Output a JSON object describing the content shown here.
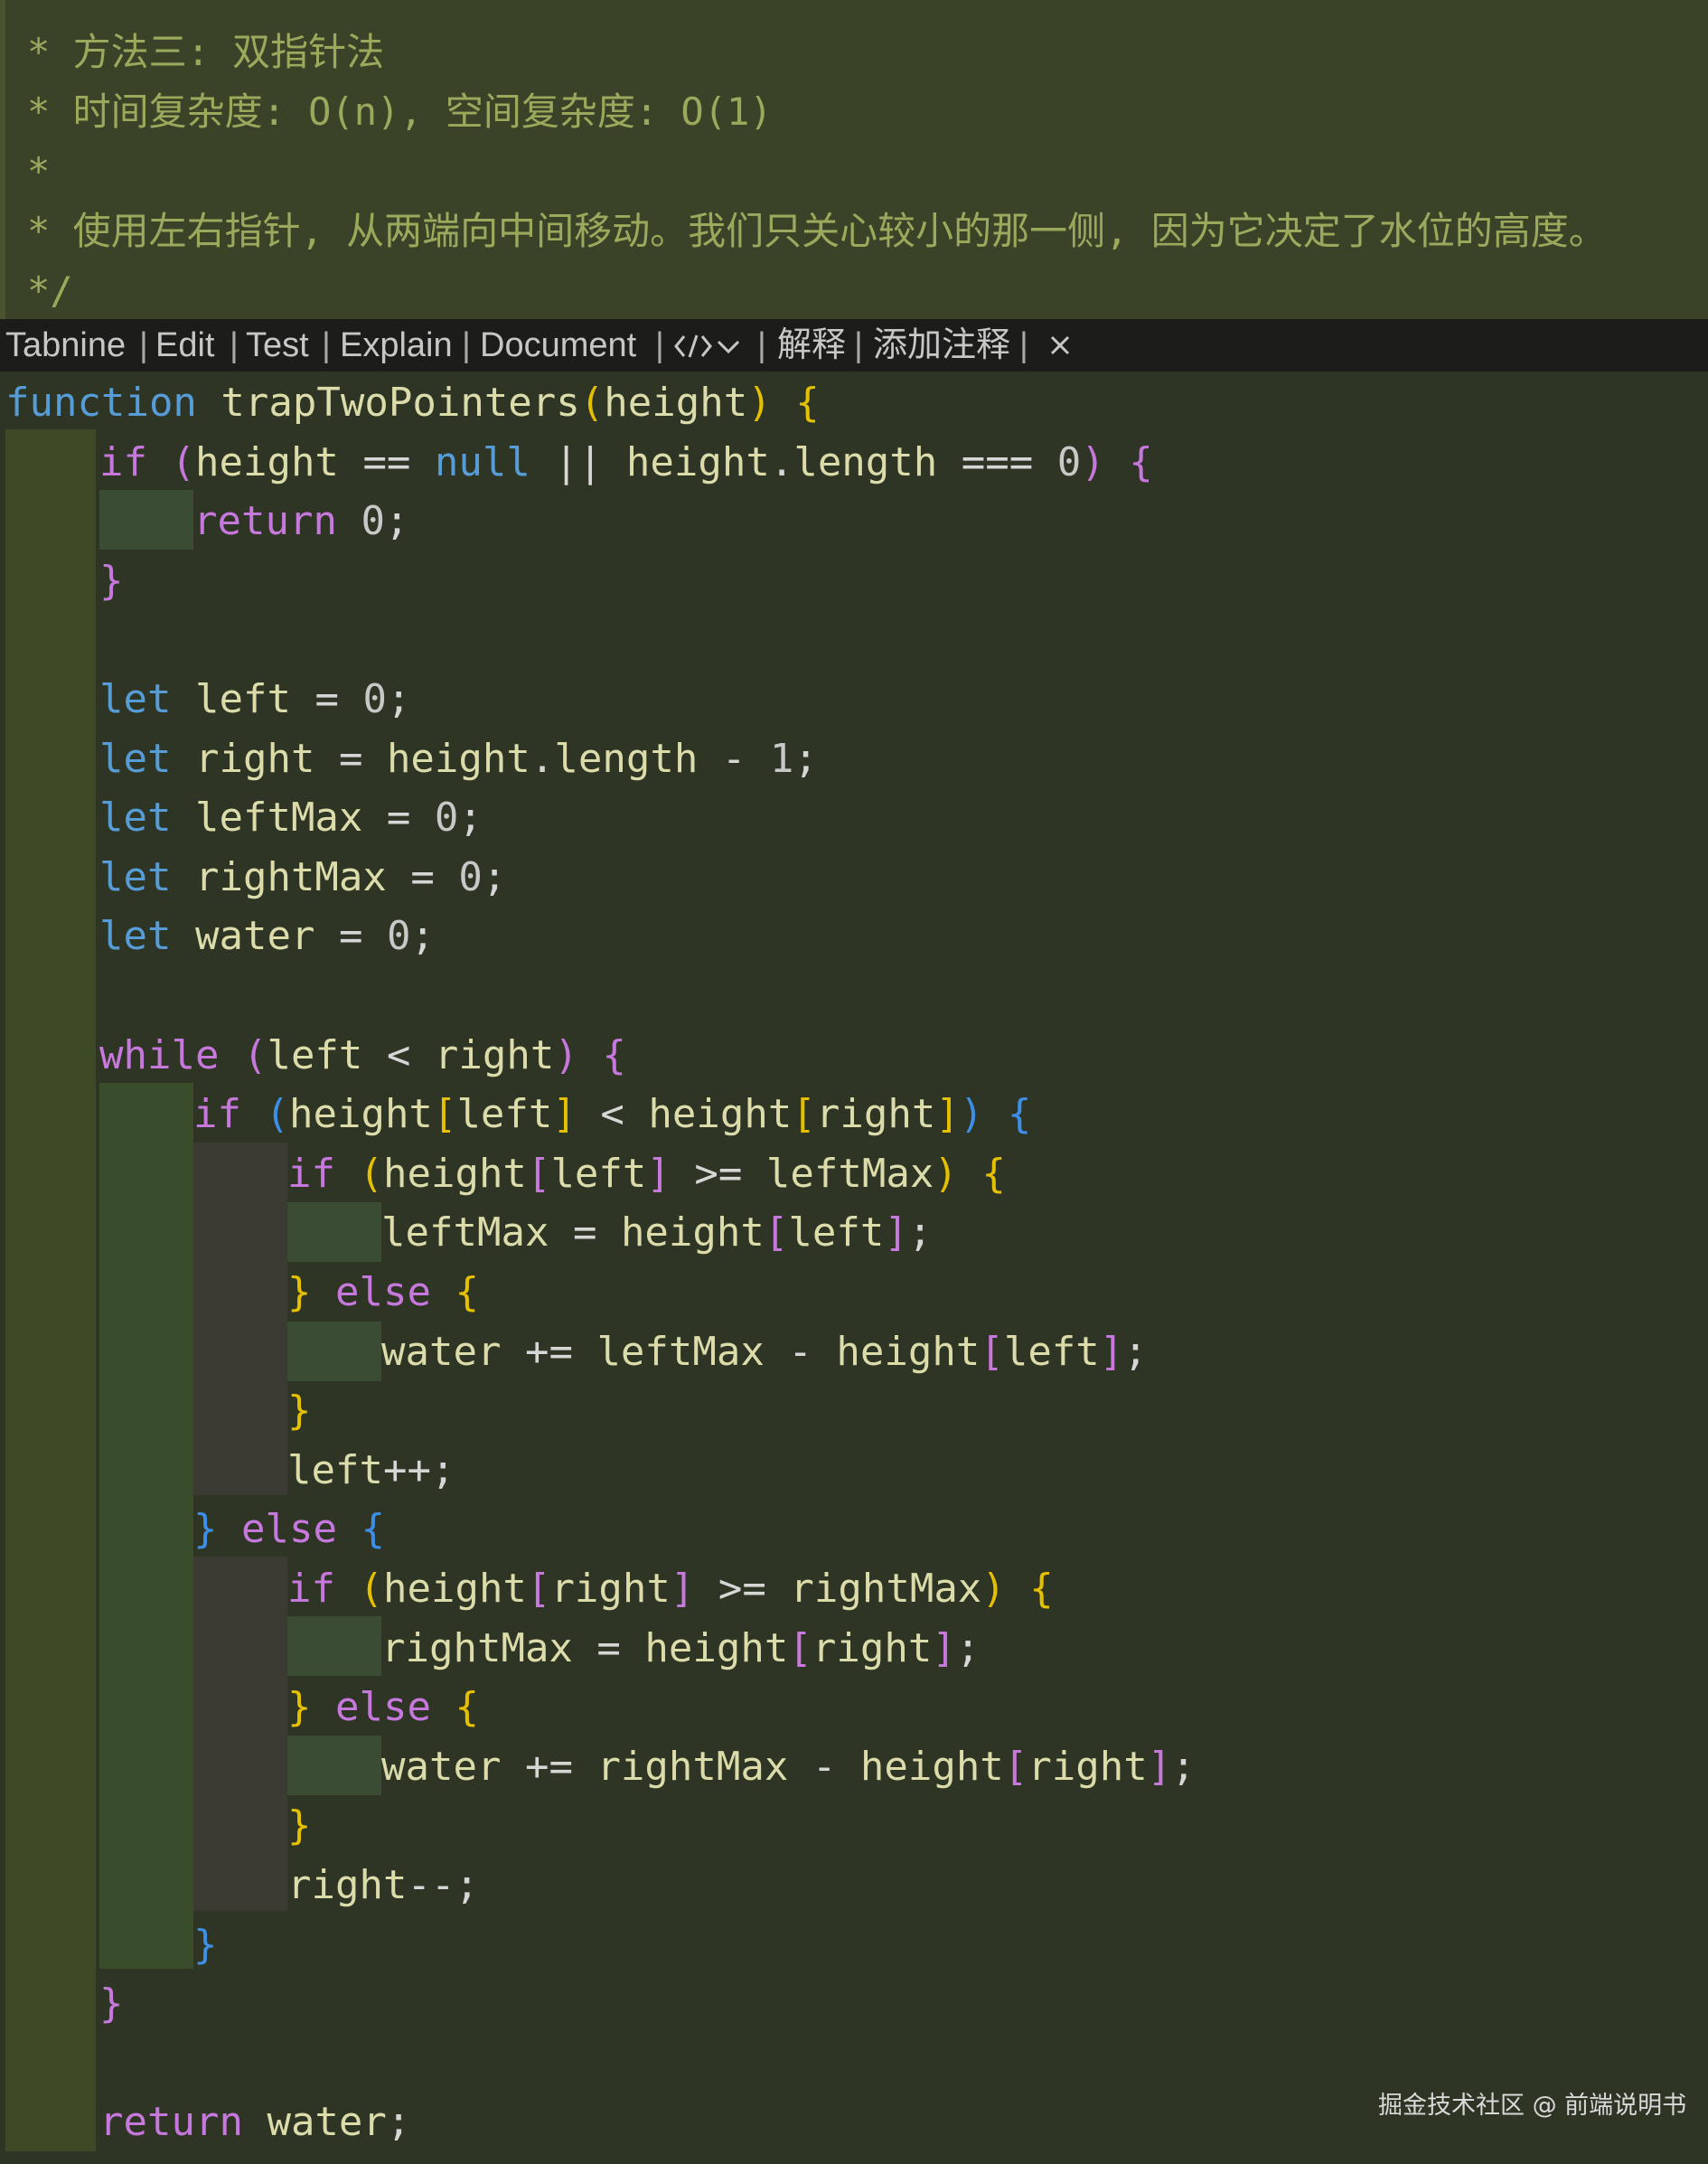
{
  "comment": {
    "lines": [
      "* 方法三: 双指针法",
      "* 时间复杂度: O(n), 空间复杂度: O(1)",
      "*",
      "* 使用左右指针, 从两端向中间移动。我们只关心较小的那一侧, 因为它决定了水位的高度。",
      "*/"
    ]
  },
  "codelens": {
    "items": [
      "Tabnine",
      "Edit",
      "Test",
      "Explain",
      "Document",
      "解释",
      "添加注释"
    ],
    "separator": "|",
    "icons": [
      "code-brackets-icon",
      "chevron-down-icon",
      "close-icon"
    ]
  },
  "code": {
    "function_keyword": "function",
    "function_name": "trapTwoPointers",
    "param": "height",
    "lines": [
      "function trapTwoPointers(height) {",
      "if (height == null || height.length === 0) {",
      "return 0;",
      "}",
      "",
      "let left = 0;",
      "let right = height.length - 1;",
      "let leftMax = 0;",
      "let rightMax = 0;",
      "let water = 0;",
      "",
      "while (left < right) {",
      "if (height[left] < height[right]) {",
      "if (height[left] >= leftMax) {",
      "leftMax = height[left];",
      "} else {",
      "water += leftMax - height[left];",
      "}",
      "left++;",
      "} else {",
      "if (height[right] >= rightMax) {",
      "rightMax = height[right];",
      "} else {",
      "water += rightMax - height[right];",
      "}",
      "right--;",
      "}",
      "}",
      "",
      "return water;"
    ]
  },
  "watermark": "掘金技术社区 @ 前端说明书",
  "colors": {
    "background": "#2f3524",
    "comment_bg": "#3a4328",
    "comment_text": "#9ba95c",
    "keyword_blue": "#569cd6",
    "keyword_pink": "#c678dd",
    "identifier": "#dcdcaa",
    "bracket_yellow": "#e5c000",
    "bracket_pink": "#c678dd",
    "bracket_blue": "#3d8ee6"
  }
}
